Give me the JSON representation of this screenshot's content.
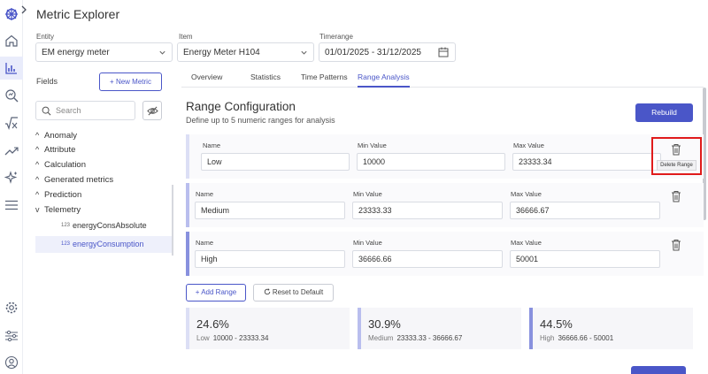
{
  "app": {
    "title": "Metric Explorer"
  },
  "filters": {
    "entity_label": "Entity",
    "entity_value": "EM energy meter",
    "item_label": "Item",
    "item_value": "Energy Meter H104",
    "timerange_label": "Timerange",
    "timerange_value": "01/01/2025 - 31/12/2025"
  },
  "fields": {
    "label": "Fields",
    "new_metric": "+ New Metric",
    "search_placeholder": "Search",
    "groups": [
      "Anomaly",
      "Attribute",
      "Calculation",
      "Generated metrics",
      "Prediction",
      "Telemetry"
    ],
    "leaves": [
      {
        "badge": "123",
        "label": "energyConsAbsolute"
      },
      {
        "badge": "123",
        "label": "energyConsumption"
      }
    ]
  },
  "tabs": [
    "Overview",
    "Statistics",
    "Time Patterns",
    "Range Analysis"
  ],
  "active_tab": "Range Analysis",
  "range_config": {
    "title": "Range Configuration",
    "subtitle": "Define up to 5 numeric ranges for analysis",
    "rebuild": "Rebuild",
    "name_label": "Name",
    "min_label": "Min Value",
    "max_label": "Max Value",
    "ranges": [
      {
        "name": "Low",
        "min": "10000",
        "max": "23333.34"
      },
      {
        "name": "Medium",
        "min": "23333.33",
        "max": "36666.67"
      },
      {
        "name": "High",
        "min": "36666.66",
        "max": "50001"
      }
    ],
    "tooltip": "Delete Range",
    "add_range": "+ Add Range",
    "reset": "Reset to Default"
  },
  "stats": [
    {
      "pct": "24.6%",
      "name": "Low",
      "range": "10000 - 23333.34"
    },
    {
      "pct": "30.9%",
      "name": "Medium",
      "range": "23333.33 - 36666.67"
    },
    {
      "pct": "44.5%",
      "name": "High",
      "range": "36666.66 - 50001"
    }
  ],
  "colors": {
    "accent": "#4a56c8",
    "range_low": "#dcdff5",
    "range_medium": "#b9beee",
    "range_high": "#8891de",
    "highlight": "#e01b1b"
  }
}
